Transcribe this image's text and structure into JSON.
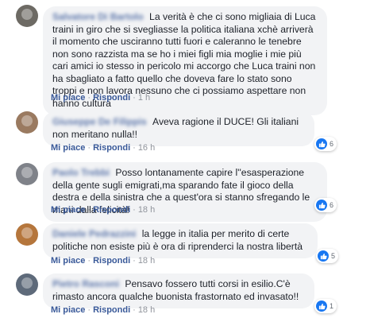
{
  "comments": [
    {
      "author": "Salvatore Di Bartolo",
      "text": "La verità è che ci sono migliaia di Luca traini in giro che si svegliasse la politica italiana xchè arriverà il momento che usciranno tutti fuori e caleranno le tenebre non sono razzista ma se ho i miei figli mia moglie i mie più cari amici io stesso in pericolo mi accorgo che Luca traini non ha sbagliato a fatto quello che doveva fare lo stato sono troppi e non lavora nessuno che ci possiamo aspettare non hanno cultura",
      "like_label": "Mi piace",
      "reply_label": "Rispondi",
      "time": "1 h"
    },
    {
      "author": "Giuseppe De Filippis",
      "text": "Aveva ragione il DUCE! Gli italiani non meritano nulla!!",
      "like_label": "Mi piace",
      "reply_label": "Rispondi",
      "time": "16 h",
      "reactions": "6"
    },
    {
      "author": "Paolo Trebbi",
      "text": "Posso lontanamente capire l''esasperazione della gente sugli emigrati,ma sparando fate il gioco della destra e della sinistra che a quest'ora si stanno sfregando le mani dalla felicità!",
      "like_label": "Mi piace",
      "reply_label": "Rispondi",
      "time": "18 h",
      "reactions": "6"
    },
    {
      "author": "Daniele Pedrazzini",
      "text": "la legge in italia per merito di certe politiche non esiste più è ora di riprenderci la nostra libertà",
      "like_label": "Mi piace",
      "reply_label": "Rispondi",
      "time": "18 h",
      "reactions": "5"
    },
    {
      "author": "Pietro Rasconi",
      "text": "Pensavo fossero tutti corsi in esilio.C'è rimasto ancora qualche buonista frastornato ed invasato!!",
      "like_label": "Mi piace",
      "reply_label": "Rispondi",
      "time": "18 h",
      "reactions": "1"
    }
  ],
  "colors": {
    "link": "#385898",
    "bubble": "#f2f3f5",
    "like": "#1877f2"
  }
}
